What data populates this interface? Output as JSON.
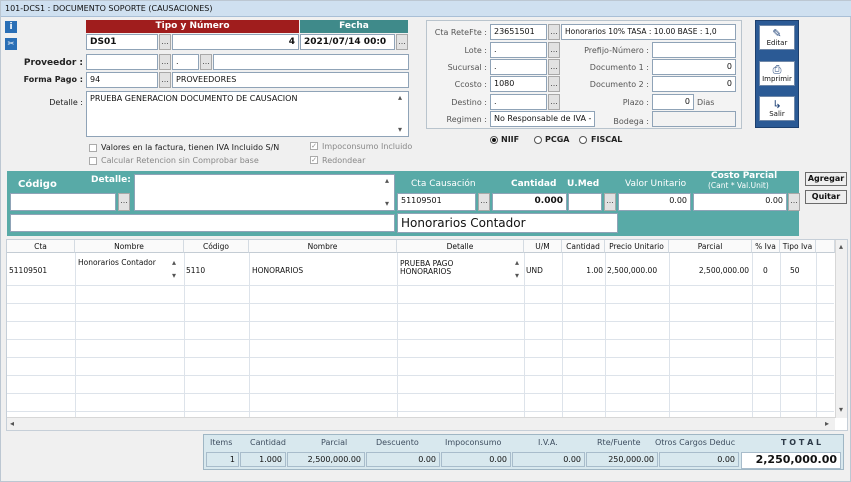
{
  "window": {
    "title": "101-DCS1 : DOCUMENTO SOPORTE (CAUSACIONES)"
  },
  "header": {
    "tipo_numero_label": "Tipo y Número",
    "fecha_label": "Fecha",
    "tipo": "DS01",
    "dots": "...",
    "numero": "4",
    "fecha": "2021/07/14 00:0"
  },
  "left": {
    "proveedor_label": "Proveedor :",
    "proveedor_value": "",
    "proveedor_dot": ".",
    "forma_pago_label": "Forma Pago :",
    "forma_pago_code": "94",
    "forma_pago_name": "PROVEEDORES",
    "detalle_label": "Detalle :",
    "detalle_value": "PRUEBA GENERACION DOCUMENTO DE CAUSACION",
    "chk_iva_label": "Valores en la factura, tienen  IVA Incluido S/N",
    "chk_ret_label": "Calcular Retencion sin Comprobar base",
    "chk_impo_label": "Impoconsumo Incluido",
    "chk_red_label": "Redondear",
    "chk_mark": "✓"
  },
  "right": {
    "cta_retefte_label": "Cta ReteFte :",
    "cta_retefte_value": "23651501",
    "retefte_info": "Honorarios 10%   TASA : 10.00   BASE : 1,0",
    "lote_label": "Lote :",
    "lote_value": ".",
    "sucursal_label": "Sucursal :",
    "sucursal_value": ".",
    "ccosto_label": "Ccosto :",
    "ccosto_value": "1080",
    "destino_label": "Destino :",
    "destino_value": ".",
    "regimen_label": "Regimen :",
    "regimen_value": "No Responsable de IVA -",
    "prefijo_label": "Prefijo-Número :",
    "prefijo_value": "",
    "doc1_label": "Documento 1 :",
    "doc1_value": "0",
    "doc2_label": "Documento 2 :",
    "doc2_value": "0",
    "plazo_label": "Plazo :",
    "plazo_value": "0",
    "plazo_unit": "Dias",
    "bodega_label": "Bodega :",
    "bodega_value": "",
    "niif": "NIIF",
    "pcga": "PCGA",
    "fiscal": "FISCAL"
  },
  "sidebar": {
    "editar": "Editar",
    "imprimir": "Imprimir",
    "salir": "Salir"
  },
  "entry": {
    "codigo_label": "Código",
    "detalle_label": "Detalle:",
    "cta_causacion_label": "Cta Causación",
    "cantidad_label": "Cantidad",
    "umed_label": "U.Med",
    "valor_unitario_label": "Valor Unitario",
    "costo_parcial_label": "Costo Parcial",
    "costo_parcial_sub": "(Cant * Val.Unit)",
    "codigo_value": "",
    "cta_value": "51109501",
    "cantidad_value": "0.000",
    "umed_value": "",
    "valor_unitario_value": "0.00",
    "costo_parcial_value": "0.00",
    "cuenta_nombre": "Honorarios Contador",
    "agregar": "Agregar",
    "quitar": "Quitar"
  },
  "grid": {
    "columns": [
      "Cta",
      "Nombre",
      "Código",
      "Nombre",
      "Detalle",
      "U/M",
      "Cantidad",
      "Precio Unitario",
      "Parcial",
      "% Iva",
      "Tipo Iva"
    ],
    "row": {
      "cta": "51109501",
      "nombre1": "Honorarios Contador",
      "codigo": "5110",
      "nombre2": "HONORARIOS",
      "detalle1": "PRUEBA PAGO",
      "detalle2": "HONORARIOS",
      "um": "UND",
      "cantidad": "1.00",
      "precio": "2,500,000.00",
      "parcial": "2,500,000.00",
      "iva": "0",
      "tipo_iva": "50"
    }
  },
  "totals": {
    "labels": [
      "Items",
      "Cantidad",
      "Parcial",
      "Descuento",
      "Impoconsumo",
      "I.V.A.",
      "Rte/Fuente",
      "Otros Cargos Deduc",
      "T O T A L"
    ],
    "values": [
      "1",
      "1.000",
      "2,500,000.00",
      "0.00",
      "0.00",
      "0.00",
      "250,000.00",
      "0.00",
      "2,250,000.00"
    ]
  },
  "icons": {
    "info": "i",
    "clip": "📎",
    "up": "▴",
    "down": "▾",
    "left": "◂",
    "right": "▸"
  }
}
